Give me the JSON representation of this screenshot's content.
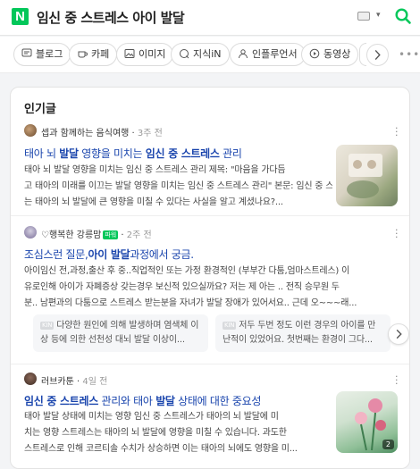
{
  "header": {
    "logo": "N",
    "query": "임신 중 스트레스 아이 발달"
  },
  "tabs": [
    {
      "label": "블로그",
      "icon": "blog-icon"
    },
    {
      "label": "카페",
      "icon": "cafe-icon"
    },
    {
      "label": "이미지",
      "icon": "image-icon"
    },
    {
      "label": "지식iN",
      "icon": "kin-icon"
    },
    {
      "label": "인플루언서",
      "icon": "influencer-icon"
    },
    {
      "label": "동영상",
      "icon": "video-icon"
    }
  ],
  "section": {
    "title": "인기글"
  },
  "posts": [
    {
      "author": "셉과 함께하는 음식여행",
      "time": "3주 전",
      "title_segments": [
        {
          "t": "태아 뇌 ",
          "b": false
        },
        {
          "t": "발달",
          "b": true
        },
        {
          "t": " 영향을 미치는 ",
          "b": false
        },
        {
          "t": "임신 중 스트레스",
          "b": true
        },
        {
          "t": " 관리",
          "b": false
        }
      ],
      "desc_lines": [
        "태아 뇌 발달 영향을 미치는 임신 중 스트레스 관리 제목: \"마음을 가다듬",
        "고 태아의 미래를 이끄는 발달 영향을 미치는 임신 중 스트레스 관리\" 본문: 임신 중 스트레스",
        "는 태아의 뇌 발달에 큰 영향을 미칠 수 있다는 사실을 알고 계셨나요?..."
      ]
    },
    {
      "author": "♡행복한 강릉맘",
      "badge": "파워",
      "time": "2주 전",
      "title_segments": [
        {
          "t": "조심스런 질문,",
          "b": false
        },
        {
          "t": "아이 발달",
          "b": true
        },
        {
          "t": "과정에서 궁금.",
          "b": false
        }
      ],
      "desc_lines": [
        "아이임신 전,과정,출산 후 중..직업적인 또는 가정 환경적인 (부부간 다툼,엄마스트레스) 이",
        "유로인해 아이가 자폐증상 갖는경우 보신적 있으실까요? 저는 제 아는 .. 전직 승무원 두",
        "분.. 남편과의 다툼으로 스트레스 받는분을 자녀가 발달 장애가 있어서요.. 근데 오~~~래..."
      ],
      "snippets": [
        "다양한 원인에 의해 발생하며 염색체 이상 등에 의한 선천성 대뇌 발달 이상이...",
        "저두 두번 정도 이런 경우의 아이를 만난적이 있었어요. 첫번째는 환경이 그다..."
      ]
    },
    {
      "author": "러브카툰",
      "time": "4일 전",
      "title_segments": [
        {
          "t": "임신 중 스트레스",
          "b": true
        },
        {
          "t": " 관리와 태아 ",
          "b": false
        },
        {
          "t": "발달",
          "b": true
        },
        {
          "t": " 상태에 대한 중요성",
          "b": false
        }
      ],
      "desc_lines": [
        "태아 발달 상태에 미치는 영향 임신 중 스트레스가 태아의 뇌 발달에 미",
        "치는 영향 스트레스는 태아의 뇌 발달에 영향을 미칠 수 있습니다. 과도한",
        "스트레스로 인해 코르티솔 수치가 상승하면 이는 태아의 뇌에도 영향을 미..."
      ],
      "thumb_count": "2"
    }
  ],
  "colors": {
    "brand": "#03c75a",
    "link": "#1a45ad"
  }
}
